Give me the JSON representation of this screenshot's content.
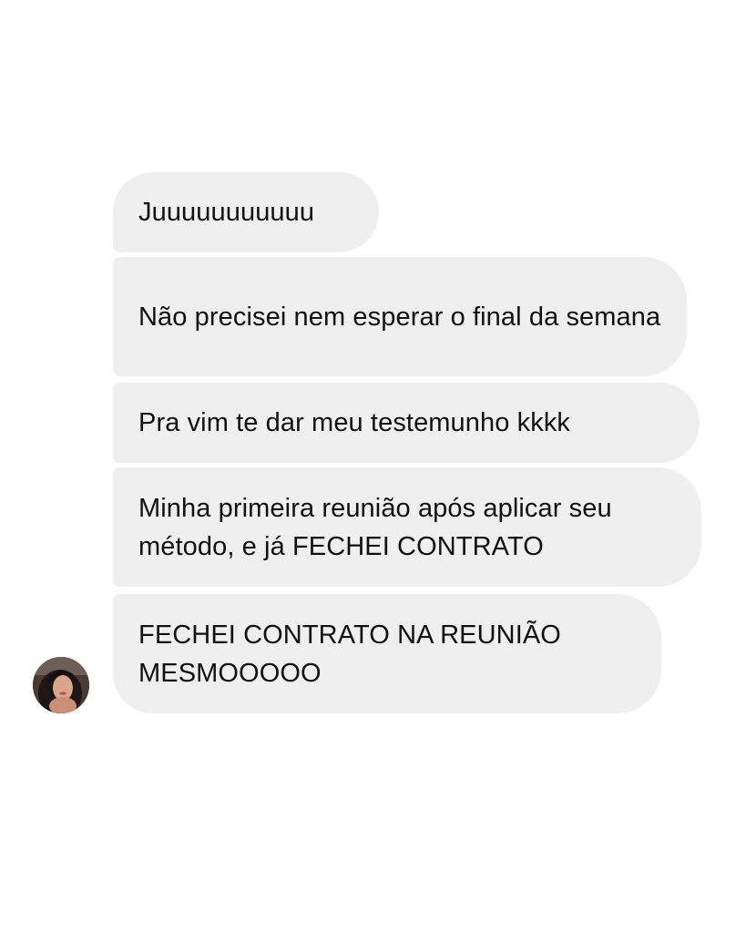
{
  "messages": [
    {
      "text": "Juuuuuuuuuuu"
    },
    {
      "text": "Não precisei nem esperar o final da semana"
    },
    {
      "text": "Pra vim te dar meu testemunho kkkk"
    },
    {
      "text": "Minha primeira reunião após aplicar seu método, e já FECHEI CONTRATO"
    },
    {
      "text": "FECHEI CONTRATO NA REUNIÃO MESMOOOOO"
    }
  ],
  "colors": {
    "bubble_background": "#efefef",
    "text": "#111111",
    "page_background": "#ffffff"
  },
  "icons": {
    "sender_avatar": "profile-photo-avatar"
  }
}
